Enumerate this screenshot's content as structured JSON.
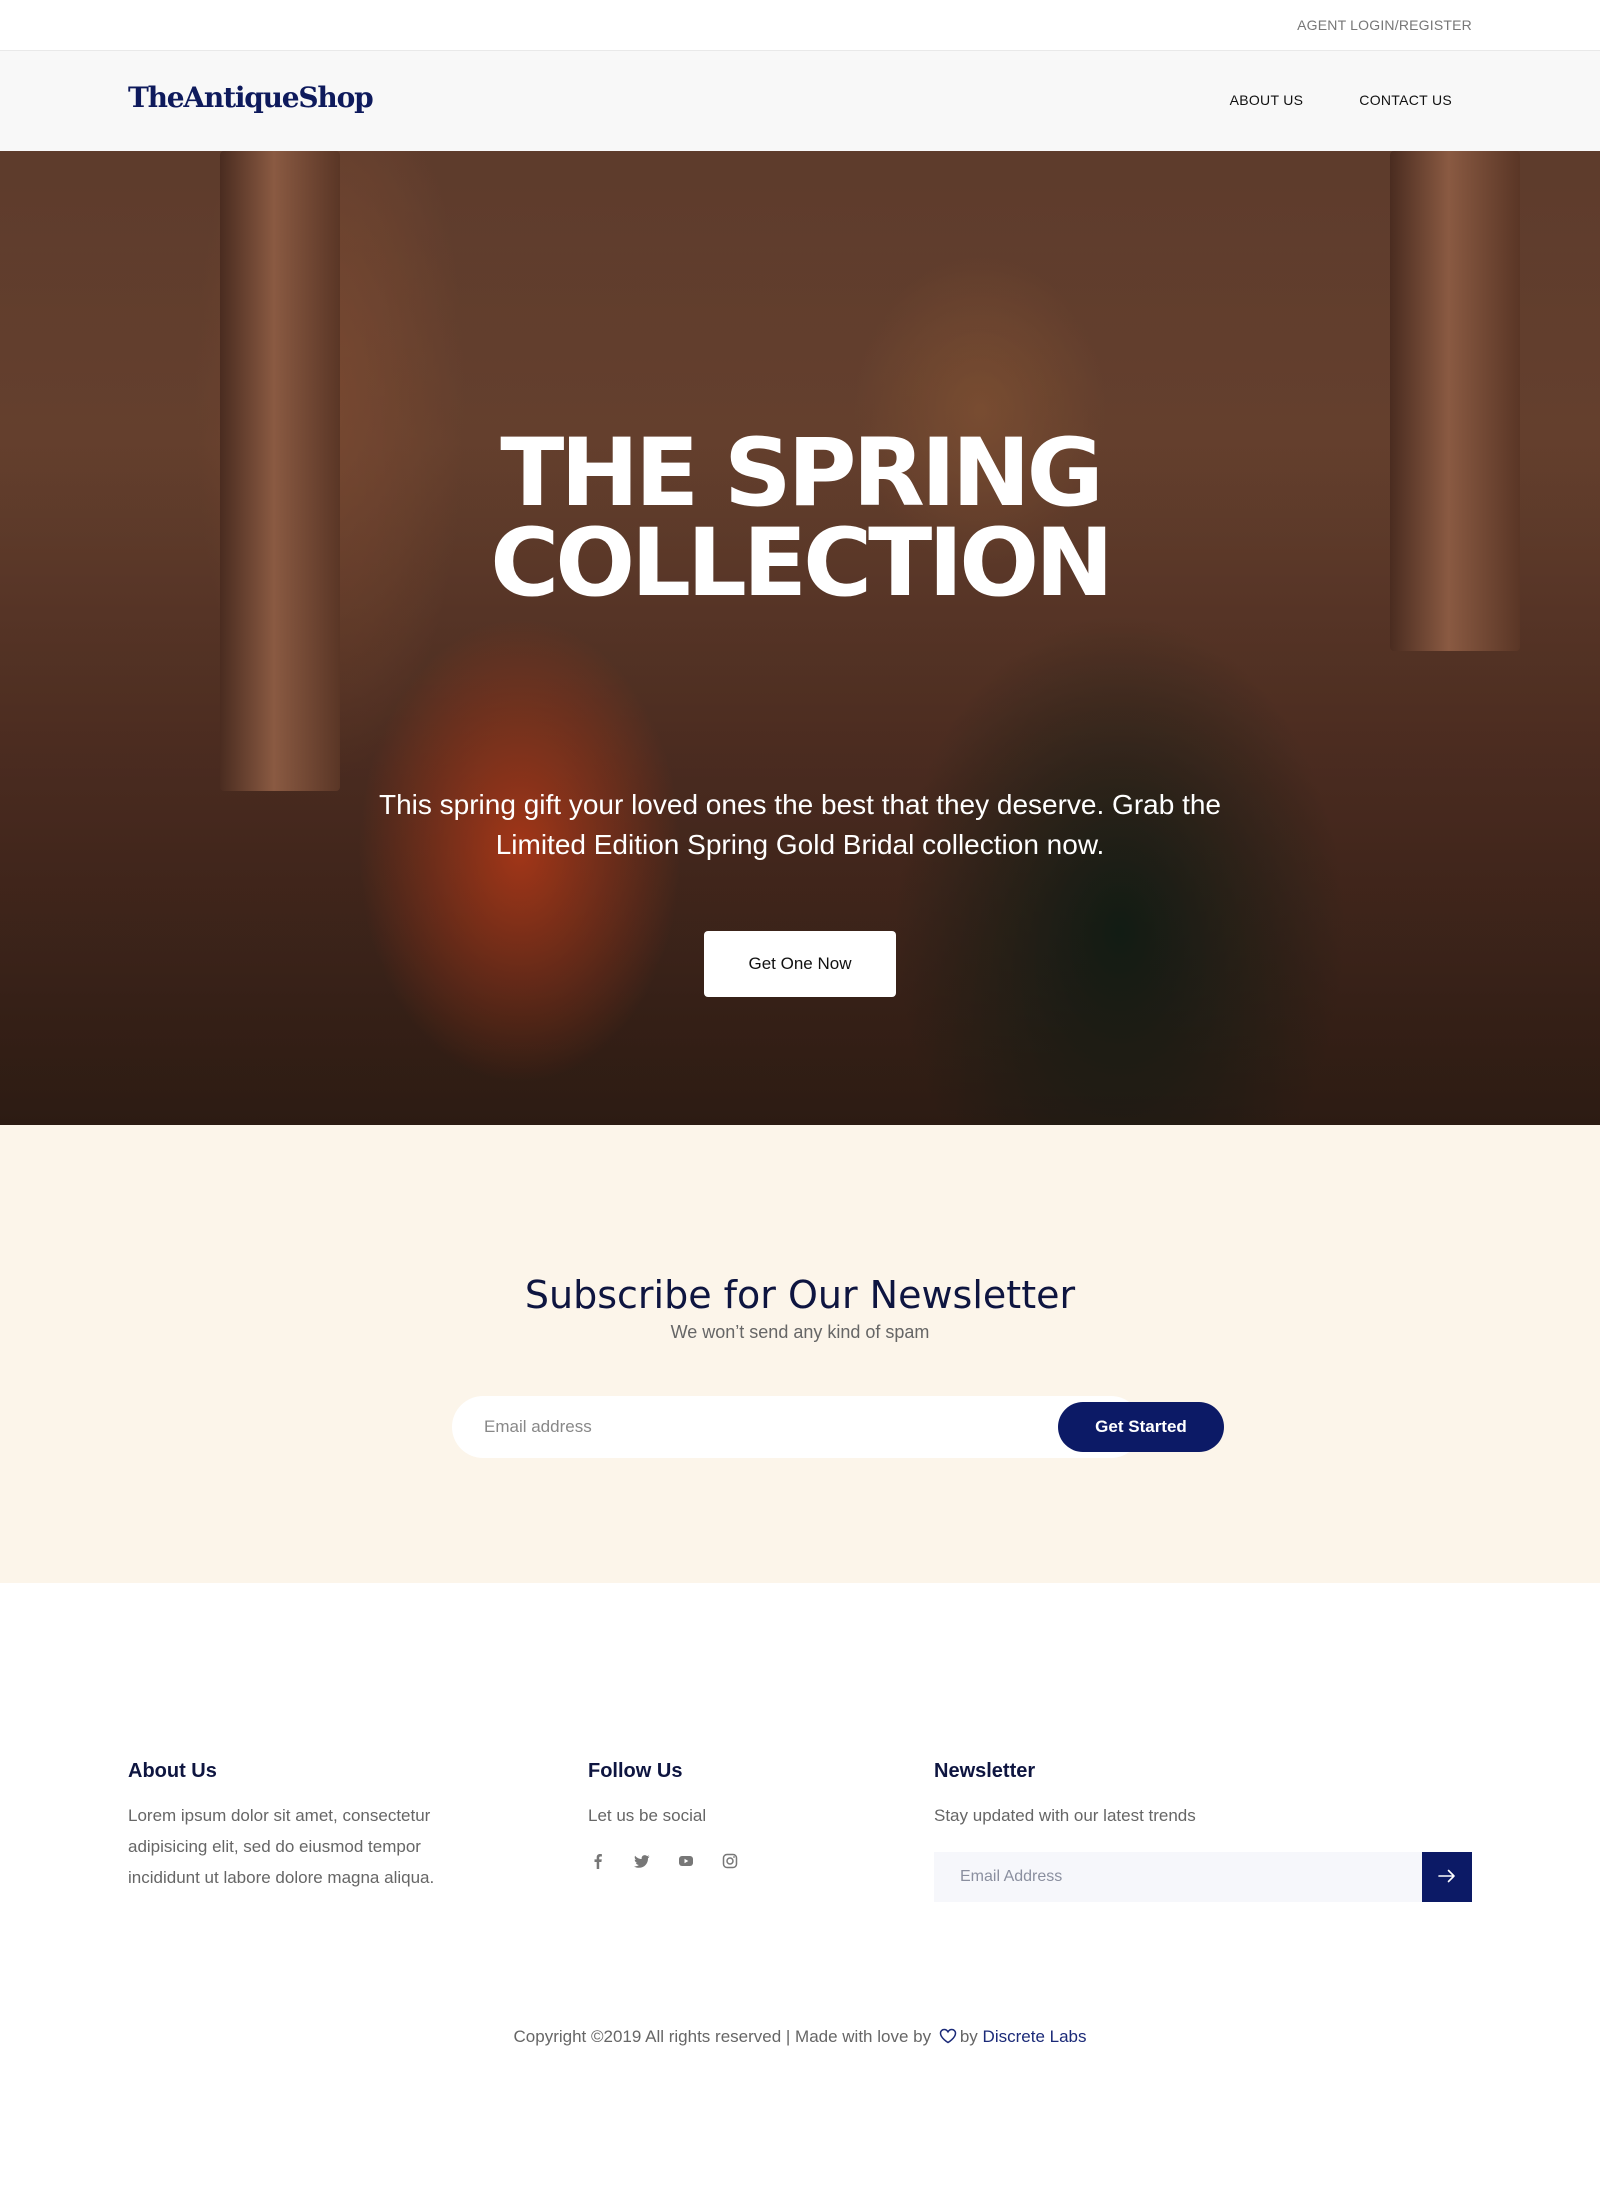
{
  "topbar": {
    "login_label": "AGENT LOGIN/REGISTER"
  },
  "header": {
    "logo": "TheAntiqueShop",
    "nav": [
      "ABOUT US",
      "CONTACT US"
    ]
  },
  "hero": {
    "title_line1": "THE SPRING",
    "title_line2": "COLLECTION",
    "subtitle": "This spring gift your loved ones the best that they deserve. Grab the Limited Edition Spring Gold Bridal collection now.",
    "button_label": "Get One Now"
  },
  "subscribe": {
    "heading": "Subscribe for Our Newsletter",
    "subtext": "We won’t send any kind of spam",
    "input_placeholder": "Email address",
    "button_label": "Get Started"
  },
  "footer": {
    "about": {
      "heading": "About Us",
      "text": "Lorem ipsum dolor sit amet, consectetur adipisicing elit, sed do eiusmod tempor incididunt ut labore dolore magna aliqua."
    },
    "follow": {
      "heading": "Follow Us",
      "text": "Let us be social",
      "icons": [
        "facebook-icon",
        "twitter-icon",
        "youtube-icon",
        "instagram-icon"
      ]
    },
    "newsletter": {
      "heading": "Newsletter",
      "text": "Stay updated with our latest trends",
      "input_placeholder": "Email Address",
      "button_icon": "arrow-right-icon"
    },
    "copyright": {
      "prefix": "Copyright ©2019 All rights reserved | Made with love by",
      "by": "by",
      "link": "Discrete Labs"
    }
  },
  "colors": {
    "brand_navy": "#0c1a66",
    "subscribe_bg": "#fcf5ea",
    "header_bg": "#f8f8f8"
  }
}
